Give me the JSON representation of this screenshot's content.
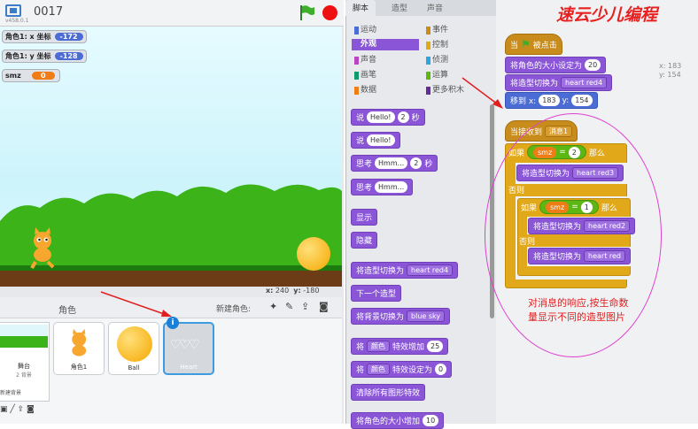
{
  "stage": {
    "project_title": "0017",
    "version": "v458.0.1",
    "monitors": [
      {
        "label": "角色1: x 坐标",
        "value": "-172"
      },
      {
        "label": "角色1: y 坐标",
        "value": "-128"
      },
      {
        "label": "smz",
        "value": "0"
      }
    ],
    "coords": {
      "x_label": "x:",
      "x": "240",
      "y_label": "y:",
      "y": "-180"
    },
    "icons": [
      "green-flag-icon",
      "stop-icon",
      "presentation-mode-icon"
    ]
  },
  "sprites": {
    "header": "角色",
    "new_sprite_label": "新建角色:",
    "stage_card": {
      "name": "舞台",
      "sub": "2 背景"
    },
    "new_backdrop_label": "新建背景",
    "cards": [
      {
        "name": "角色1"
      },
      {
        "name": "Ball"
      },
      {
        "name": "Heart"
      }
    ]
  },
  "palette": {
    "tabs": [
      "脚本",
      "造型",
      "声音"
    ],
    "categories_left": [
      "运动",
      "外观",
      "声音",
      "画笔",
      "数据"
    ],
    "categories_right": [
      "事件",
      "控制",
      "侦测",
      "运算",
      "更多积木"
    ],
    "selected_category": "外观",
    "blocks": [
      {
        "parts": [
          "说",
          "Hello!",
          "2",
          "秒"
        ]
      },
      {
        "parts": [
          "说",
          "Hello!"
        ]
      },
      {
        "parts": [
          "思考",
          "Hmm...",
          "2",
          "秒"
        ]
      },
      {
        "parts": [
          "思考",
          "Hmm..."
        ]
      },
      {
        "parts": [
          "显示"
        ]
      },
      {
        "parts": [
          "隐藏"
        ]
      },
      {
        "parts": [
          "将造型切换为",
          "heart red4"
        ]
      },
      {
        "parts": [
          "下一个造型"
        ]
      },
      {
        "parts": [
          "将背景切换为",
          "blue sky"
        ]
      },
      {
        "parts": [
          "将",
          "颜色",
          "特效增加",
          "25"
        ]
      },
      {
        "parts": [
          "将",
          "颜色",
          "特效设定为",
          "0"
        ]
      },
      {
        "parts": [
          "清除所有图形特效"
        ]
      },
      {
        "parts": [
          "将角色的大小增加",
          "10"
        ]
      }
    ]
  },
  "script": {
    "readout": {
      "x": "x: 183",
      "y": "y: 154"
    },
    "script1": {
      "hat": "当 被点击",
      "size_label": "将角色的大小设定为",
      "size": "20",
      "costume_label": "将造型切换为",
      "costume": "heart red4",
      "goto_label": "移到 x:",
      "x": "183",
      "y_label": "y:",
      "y": "154"
    },
    "script2": {
      "hat_label": "当接收到",
      "message": "消息1",
      "if1": {
        "kw": "如果",
        "var": "smz",
        "op": "=",
        "val": "2",
        "then": "那么"
      },
      "costume_a": "heart red3",
      "else1": "否则",
      "if2": {
        "kw": "如果",
        "var": "smz",
        "op": "=",
        "val": "1",
        "then": "那么"
      },
      "costume_b": "heart red2",
      "else2": "否则",
      "costume_c": "heart red",
      "switch_label": "将造型切换为"
    },
    "annotation": "对消息的响应,按生命数量显示不同的造型图片",
    "watermark": "速云少儿编程"
  },
  "colors": {
    "looks": "#8a55d7",
    "events": "#c88c1c",
    "control": "#e1a91a",
    "operators": "#5cb712",
    "motion": "#4a6cd4",
    "variable": "#ee7d16",
    "annotation": "#e02020"
  }
}
